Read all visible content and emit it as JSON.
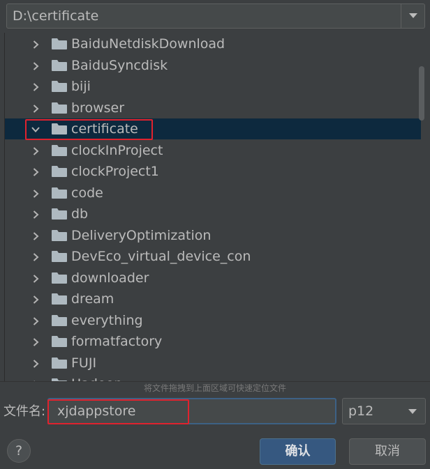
{
  "path_combo": {
    "value": "D:\\certificate"
  },
  "tree": {
    "items": [
      {
        "label": "BaiduNetdiskDownload",
        "expanded": false,
        "selected": false
      },
      {
        "label": "BaiduSyncdisk",
        "expanded": false,
        "selected": false
      },
      {
        "label": "biji",
        "expanded": false,
        "selected": false
      },
      {
        "label": "browser",
        "expanded": false,
        "selected": false
      },
      {
        "label": "certificate",
        "expanded": true,
        "selected": true
      },
      {
        "label": "clockInProject",
        "expanded": false,
        "selected": false
      },
      {
        "label": "clockProject1",
        "expanded": false,
        "selected": false
      },
      {
        "label": "code",
        "expanded": false,
        "selected": false
      },
      {
        "label": "db",
        "expanded": false,
        "selected": false
      },
      {
        "label": "DeliveryOptimization",
        "expanded": false,
        "selected": false
      },
      {
        "label": "DevEco_virtual_device_con",
        "expanded": false,
        "selected": false
      },
      {
        "label": "downloader",
        "expanded": false,
        "selected": false
      },
      {
        "label": "dream",
        "expanded": false,
        "selected": false
      },
      {
        "label": "everything",
        "expanded": false,
        "selected": false
      },
      {
        "label": "formatfactory",
        "expanded": false,
        "selected": false
      },
      {
        "label": "FUJI",
        "expanded": false,
        "selected": false
      },
      {
        "label": "Hadoop",
        "expanded": false,
        "selected": false
      }
    ]
  },
  "hint": "将文件拖拽到上面区域可快速定位文件",
  "filename": {
    "label": "文件名:",
    "value": "xjdappstore"
  },
  "extension": {
    "value": "p12"
  },
  "buttons": {
    "help": "?",
    "ok": "确认",
    "cancel": "取消"
  },
  "colors": {
    "background": "#3c3f41",
    "selection": "#0d293e",
    "highlight_box": "#e0222e",
    "primary_button": "#365880",
    "folder_icon": "#aeb9c0"
  }
}
